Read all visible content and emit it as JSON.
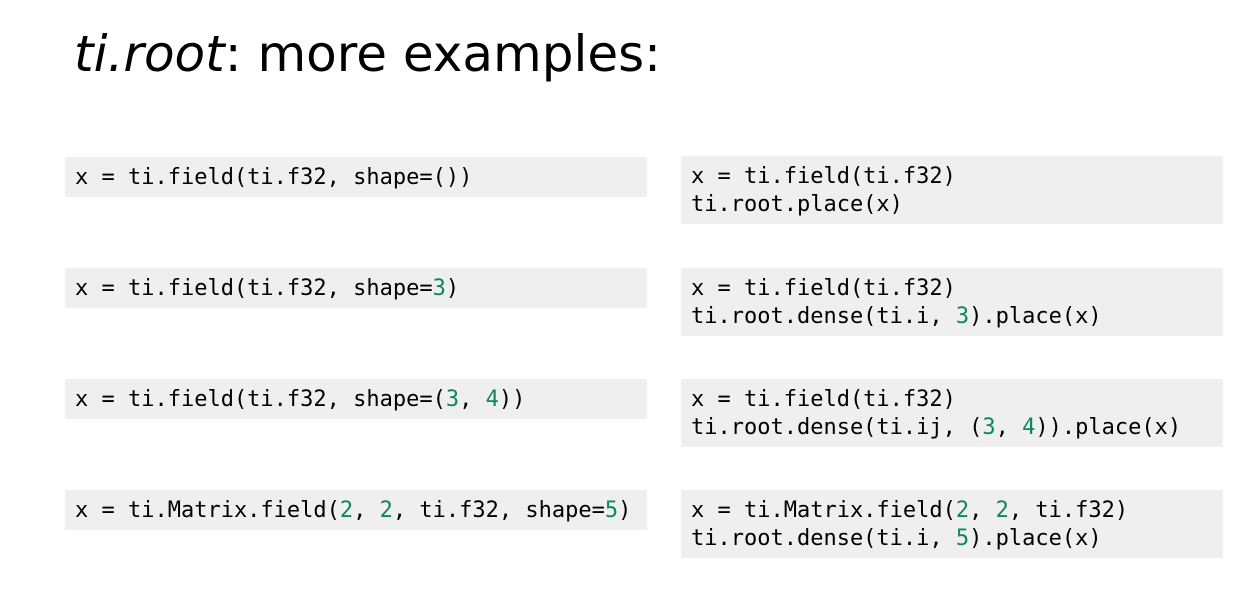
{
  "title": {
    "emphasis": "ti.root",
    "rest": ": more examples:"
  },
  "colors": {
    "number": "#0b8a55",
    "code_bg": "#efefef"
  },
  "examples": [
    {
      "left": [
        [
          {
            "t": "x = ti.field(ti.f32, shape=())"
          }
        ]
      ],
      "right": [
        [
          {
            "t": "x = ti.field(ti.f32)"
          }
        ],
        [
          {
            "t": "ti.root.place(x)"
          }
        ]
      ]
    },
    {
      "left": [
        [
          {
            "t": "x = ti.field(ti.f32, shape="
          },
          {
            "t": "3",
            "n": true
          },
          {
            "t": ")"
          }
        ]
      ],
      "right": [
        [
          {
            "t": "x = ti.field(ti.f32)"
          }
        ],
        [
          {
            "t": "ti.root.dense(ti.i, "
          },
          {
            "t": "3",
            "n": true
          },
          {
            "t": ").place(x)"
          }
        ]
      ]
    },
    {
      "left": [
        [
          {
            "t": "x = ti.field(ti.f32, shape=("
          },
          {
            "t": "3",
            "n": true
          },
          {
            "t": ", "
          },
          {
            "t": "4",
            "n": true
          },
          {
            "t": "))"
          }
        ]
      ],
      "right": [
        [
          {
            "t": "x = ti.field(ti.f32)"
          }
        ],
        [
          {
            "t": "ti.root.dense(ti.ij, ("
          },
          {
            "t": "3",
            "n": true
          },
          {
            "t": ", "
          },
          {
            "t": "4",
            "n": true
          },
          {
            "t": ")).place(x)"
          }
        ]
      ]
    },
    {
      "left": [
        [
          {
            "t": "x = ti.Matrix.field("
          },
          {
            "t": "2",
            "n": true
          },
          {
            "t": ", "
          },
          {
            "t": "2",
            "n": true
          },
          {
            "t": ", ti.f32, shape="
          },
          {
            "t": "5",
            "n": true
          },
          {
            "t": ")"
          }
        ]
      ],
      "right": [
        [
          {
            "t": "x = ti.Matrix.field("
          },
          {
            "t": "2",
            "n": true
          },
          {
            "t": ", "
          },
          {
            "t": "2",
            "n": true
          },
          {
            "t": ", ti.f32)"
          }
        ],
        [
          {
            "t": "ti.root.dense(ti.i, "
          },
          {
            "t": "5",
            "n": true
          },
          {
            "t": ").place(x)"
          }
        ]
      ]
    }
  ]
}
